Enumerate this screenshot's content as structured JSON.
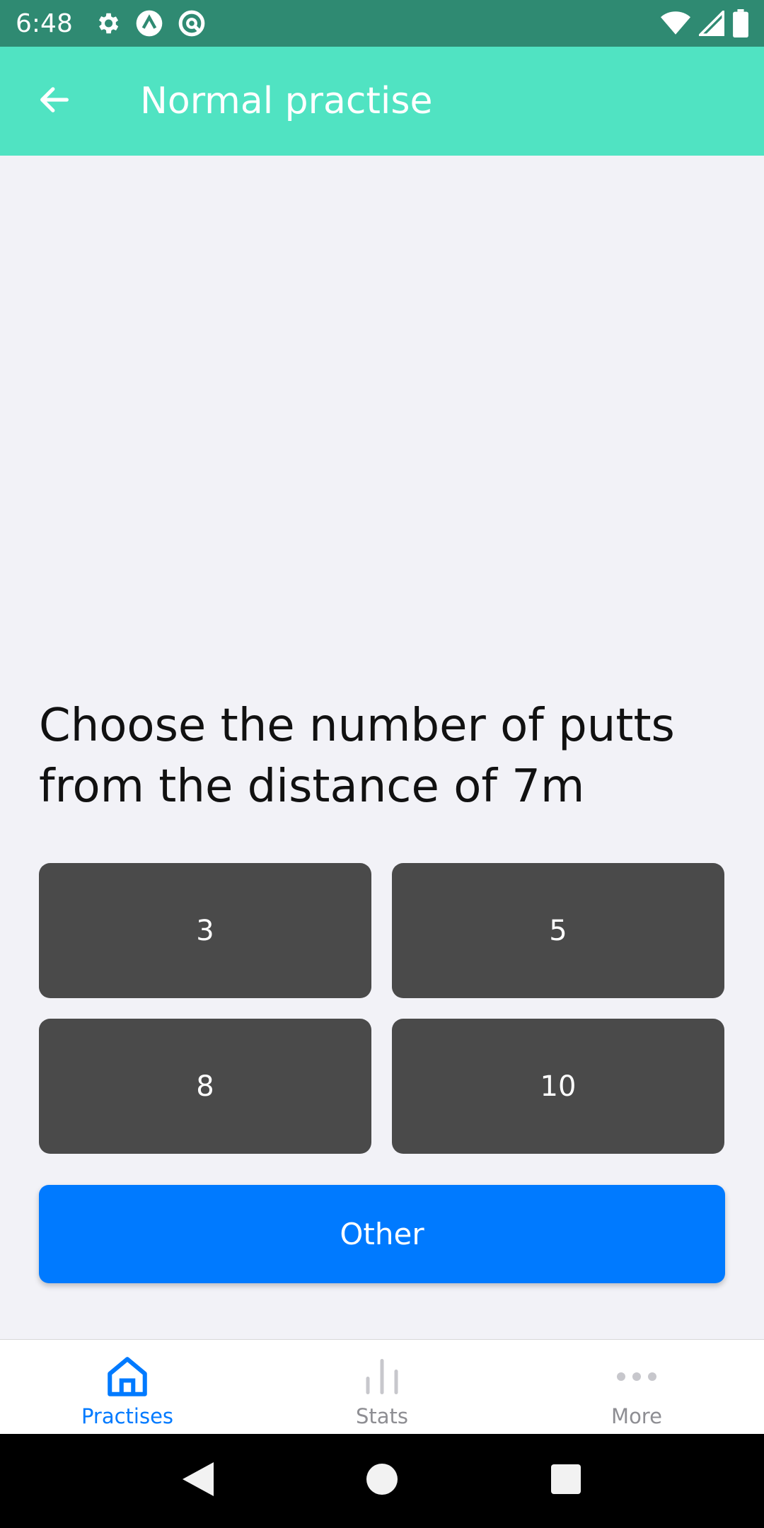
{
  "status_bar": {
    "time": "6:48",
    "left_icons": [
      "gear-icon",
      "arrow-up-circle-icon",
      "at-circle-icon"
    ],
    "right_icons": [
      "wifi-icon",
      "signal-icon",
      "battery-icon"
    ]
  },
  "app_bar": {
    "title": "Normal practise",
    "back_icon": "arrow-left-icon",
    "background": "#50e3c2"
  },
  "question": {
    "text": "Choose the number of putts from the distance of 7m"
  },
  "answers": [
    {
      "label": "3"
    },
    {
      "label": "5"
    },
    {
      "label": "8"
    },
    {
      "label": "10"
    }
  ],
  "other_button": {
    "label": "Other",
    "color": "#007aff"
  },
  "tab_bar": {
    "tabs": [
      {
        "label": "Practises",
        "icon": "home-icon",
        "active": true,
        "color": "#007aff"
      },
      {
        "label": "Stats",
        "icon": "bar-chart-icon",
        "active": false,
        "color": "#8e8e93"
      },
      {
        "label": "More",
        "icon": "more-dots-icon",
        "active": false,
        "color": "#8e8e93"
      }
    ]
  },
  "nav_bar": {
    "buttons": [
      "back-triangle-icon",
      "home-circle-icon",
      "recents-square-icon"
    ]
  }
}
